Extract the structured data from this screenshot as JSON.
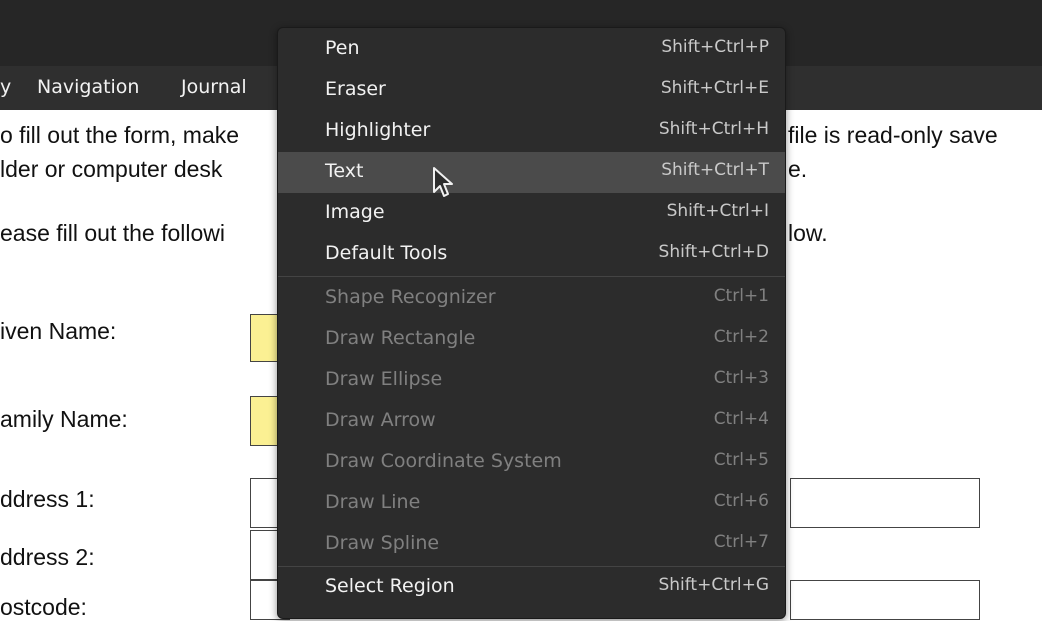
{
  "menubar": {
    "items": [
      {
        "label": "y"
      },
      {
        "label": "Navigation"
      },
      {
        "label": "Journal"
      }
    ]
  },
  "document": {
    "lines": [
      "o fill out the form, make",
      "file is read-only save",
      "lder or computer desk",
      "e.",
      "ease fill out the followi",
      "low."
    ],
    "labels": [
      "iven Name:",
      "amily Name:",
      "ddress 1:",
      "ddress 2:",
      "ostcode:"
    ]
  },
  "context_menu": {
    "items": [
      {
        "label": "Pen",
        "shortcut": "Shift+Ctrl+P",
        "enabled": true
      },
      {
        "label": "Eraser",
        "shortcut": "Shift+Ctrl+E",
        "enabled": true
      },
      {
        "label": "Highlighter",
        "shortcut": "Shift+Ctrl+H",
        "enabled": true
      },
      {
        "label": "Text",
        "shortcut": "Shift+Ctrl+T",
        "enabled": true,
        "hovered": true
      },
      {
        "label": "Image",
        "shortcut": "Shift+Ctrl+I",
        "enabled": true
      },
      {
        "label": "Default Tools",
        "shortcut": "Shift+Ctrl+D",
        "enabled": true
      },
      {
        "label": "Shape Recognizer",
        "shortcut": "Ctrl+1",
        "enabled": false
      },
      {
        "label": "Draw Rectangle",
        "shortcut": "Ctrl+2",
        "enabled": false
      },
      {
        "label": "Draw Ellipse",
        "shortcut": "Ctrl+3",
        "enabled": false
      },
      {
        "label": "Draw Arrow",
        "shortcut": "Ctrl+4",
        "enabled": false
      },
      {
        "label": "Draw Coordinate System",
        "shortcut": "Ctrl+5",
        "enabled": false
      },
      {
        "label": "Draw Line",
        "shortcut": "Ctrl+6",
        "enabled": false
      },
      {
        "label": "Draw Spline",
        "shortcut": "Ctrl+7",
        "enabled": false
      },
      {
        "label": "Select Region",
        "shortcut": "Shift+Ctrl+G",
        "enabled": true
      }
    ]
  },
  "colors": {
    "required_field": "#fbf093",
    "menu_bg": "#2c2c2c",
    "menu_hover": "#4b4b4b"
  }
}
